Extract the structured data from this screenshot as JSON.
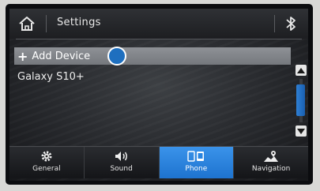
{
  "header": {
    "title": "Settings",
    "home_icon": "home-icon",
    "bluetooth_icon": "bluetooth-icon"
  },
  "device_list": {
    "add_label": "Add Device",
    "devices": [
      "Galaxy S10+"
    ]
  },
  "tabs": [
    {
      "label": "General",
      "icon": "gear-icon",
      "active": false
    },
    {
      "label": "Sound",
      "icon": "speaker-icon",
      "active": false
    },
    {
      "label": "Phone",
      "icon": "phone-icon",
      "active": true
    },
    {
      "label": "Navigation",
      "icon": "map-pin-icon",
      "active": false
    }
  ],
  "colors": {
    "accent": "#2a85e0",
    "touch_indicator": "#1e6fbf"
  }
}
